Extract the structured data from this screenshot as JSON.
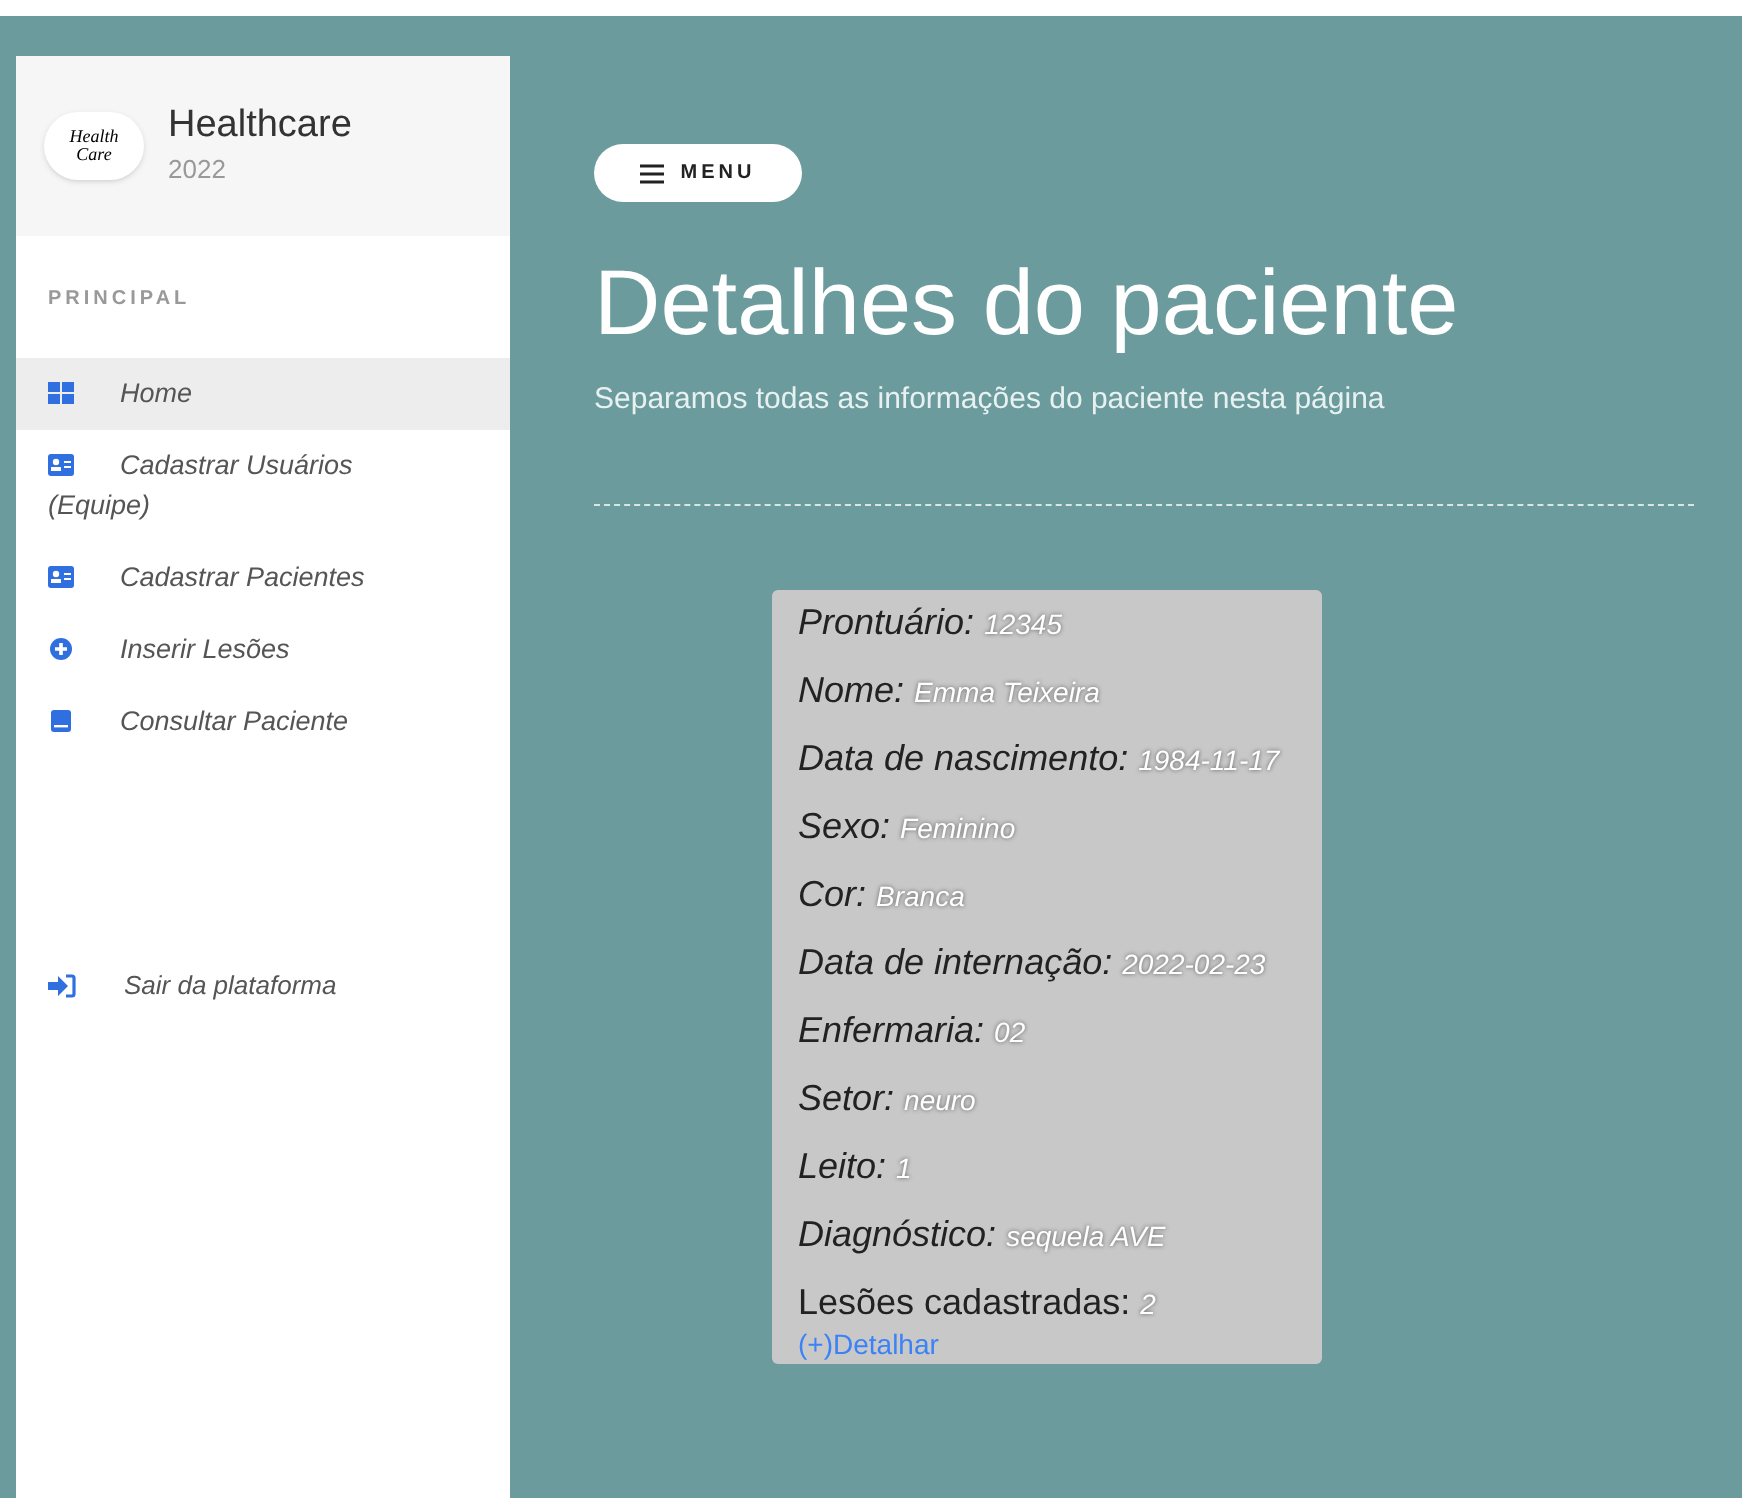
{
  "brand": {
    "logo_text": "Health Care",
    "title": "Healthcare",
    "year": "2022"
  },
  "sidebar": {
    "section": "PRINCIPAL",
    "items": [
      {
        "label": "Home",
        "kind": "grid",
        "selected": true
      },
      {
        "label": "Cadastrar Usuários (Equipe)",
        "kind": "card",
        "selected": false
      },
      {
        "label": "Cadastrar Pacientes",
        "kind": "card",
        "selected": false
      },
      {
        "label": "Inserir Lesões",
        "kind": "plus",
        "selected": false
      },
      {
        "label": "Consultar Paciente",
        "kind": "book",
        "selected": false
      }
    ],
    "logout": {
      "label": "Sair da plataforma"
    }
  },
  "menu_button": {
    "label": "MENU"
  },
  "page": {
    "title": "Detalhes do paciente",
    "subtitle": "Separamos todas as informações do paciente nesta página"
  },
  "details": [
    {
      "label": "Prontuário:",
      "value": "12345",
      "italic": true
    },
    {
      "label": "Nome:",
      "value": "Emma Teixeira",
      "italic": true
    },
    {
      "label": "Data de nascimento:",
      "value": "1984-11-17",
      "italic": true
    },
    {
      "label": "Sexo:",
      "value": "Feminino",
      "italic": true
    },
    {
      "label": "Cor:",
      "value": "Branca",
      "italic": true
    },
    {
      "label": "Data de internação:",
      "value": "2022-02-23",
      "italic": true
    },
    {
      "label": "Enfermaria:",
      "value": "02",
      "italic": true
    },
    {
      "label": "Setor:",
      "value": "neuro",
      "italic": true
    },
    {
      "label": "Leito:",
      "value": "1",
      "italic": true
    },
    {
      "label": "Diagnóstico:",
      "value": "sequela AVE",
      "italic": true
    },
    {
      "label": "Lesões cadastradas:",
      "value": "2",
      "italic": false
    }
  ],
  "detail_link": "(+)Detalhar"
}
